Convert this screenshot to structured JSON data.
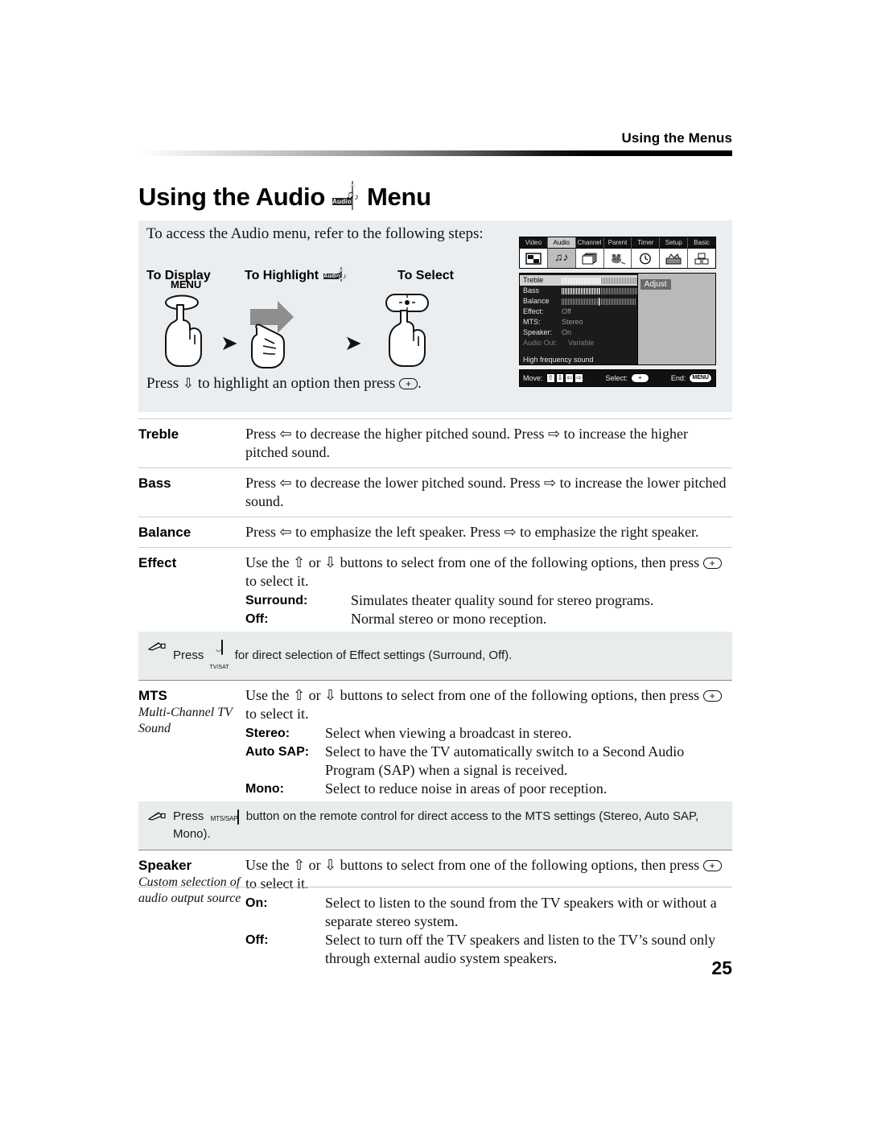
{
  "header": {
    "title": "Using the Menus"
  },
  "doc_title": {
    "before": "Using the Audio",
    "after": "Menu",
    "icon_label": "Audio"
  },
  "instructions": {
    "intro": "To access the Audio menu, refer to the following steps:",
    "step_display_label": "To Display",
    "step_highlight_label": "To Highlight",
    "step_highlight_icon_label": "Audio",
    "step_select_label": "To Select",
    "menu_button_label": "MENU",
    "footer_before": "Press",
    "footer_middle": "to highlight an option then press",
    "footer_end": ".",
    "footer_arrow": "⇩",
    "footer_select_glyph": "+"
  },
  "osd": {
    "tabs": [
      {
        "label": "Video",
        "icon": "video-icon",
        "glyph": "■",
        "active": false
      },
      {
        "label": "Audio",
        "icon": "audio-icon",
        "glyph": "♫",
        "active": true
      },
      {
        "label": "Channel",
        "icon": "channel-icon",
        "glyph": "❐",
        "active": false
      },
      {
        "label": "Parent",
        "icon": "parent-icon",
        "glyph": "◕",
        "active": false
      },
      {
        "label": "Timer",
        "icon": "timer-icon",
        "glyph": "◴",
        "active": false
      },
      {
        "label": "Setup",
        "icon": "setup-icon",
        "glyph": "⚒",
        "active": false
      },
      {
        "label": "Basic",
        "icon": "basic-icon",
        "glyph": "▦",
        "active": false
      }
    ],
    "rows": [
      {
        "label": "Treble",
        "type": "bar",
        "fill": 52,
        "selected": true,
        "dim": false
      },
      {
        "label": "Bass",
        "type": "bar",
        "fill": 50,
        "selected": false,
        "dim": false
      },
      {
        "label": "Balance",
        "type": "center",
        "fill": 50,
        "selected": false,
        "dim": false
      },
      {
        "label": "Effect:",
        "type": "value",
        "value": "Off",
        "selected": false,
        "dim": false
      },
      {
        "label": "MTS:",
        "type": "value",
        "value": "Stereo",
        "selected": false,
        "dim": false
      },
      {
        "label": "Speaker:",
        "type": "value",
        "value": "On",
        "selected": false,
        "dim": false
      },
      {
        "label": "Audio Out:",
        "type": "value",
        "value": "Variable",
        "selected": false,
        "dim": true
      }
    ],
    "hint": "High frequency sound",
    "adjust_label": "Adjust",
    "footer": {
      "move_label": "Move:",
      "move_keys": [
        "↑",
        "↓",
        "←",
        "→"
      ],
      "select_label": "Select:",
      "select_glyph": "+",
      "end_label": "End:",
      "end_glyph": "MENU"
    }
  },
  "settings": [
    {
      "term": "Treble",
      "subterm": "",
      "desc": "Press ⇦ to decrease the higher pitched sound. Press ⇨ to increase the higher pitched sound.",
      "options": []
    },
    {
      "term": "Bass",
      "subterm": "",
      "desc": "Press ⇦ to decrease the lower pitched sound. Press ⇨ to increase the lower pitched sound.",
      "options": []
    },
    {
      "term": "Balance",
      "subterm": "",
      "desc": "Press ⇦ to emphasize the left speaker. Press ⇨ to emphasize the right speaker.",
      "options": []
    },
    {
      "term": "Effect",
      "subterm": "",
      "desc_pre": "Use the ⇧ or ⇩ buttons to select from one of the following options, then press",
      "desc_post": "to select it.",
      "options": [
        {
          "name": "Surround:",
          "text": "Simulates theater quality sound for stereo programs."
        },
        {
          "name": "Off:",
          "text": "Normal stereo or mono reception."
        }
      ]
    },
    {
      "term": "MTS",
      "subterm": "Multi-Channel TV Sound",
      "desc_pre": "Use the ⇧ or ⇩ buttons to select from one of the following options, then press",
      "desc_post": "to select it.",
      "options": [
        {
          "name": "Stereo:",
          "text": "Select when viewing a broadcast in stereo."
        },
        {
          "name": "Auto SAP:",
          "text": "Select to have the TV automatically switch to a Second Audio Program (SAP) when a signal is received."
        },
        {
          "name": "Mono:",
          "text": "Select to reduce noise in areas of poor reception."
        }
      ]
    },
    {
      "term": "Speaker",
      "subterm": "Custom selection of audio output source",
      "desc_pre": "Use the ⇧ or ⇩ buttons to select from one of the following options, then press",
      "desc_post": "to select it.",
      "options": [
        {
          "name": "On:",
          "text": "Select to listen to the sound from the TV speakers with or without a separate stereo system."
        },
        {
          "name": "Off:",
          "text": "Select to turn off the TV speakers and listen to the TV’s sound only through external audio system speakers."
        }
      ]
    }
  ],
  "notes": [
    {
      "pre": "Press",
      "button_cap": "",
      "button_sub": "TV/SAT",
      "post": "for direct selection of Effect settings (Surround, Off)."
    },
    {
      "pre": "Press",
      "button_cap": "MTS/SAP",
      "button_sub": "",
      "post": "button on the remote control for direct access to the MTS settings (Stereo, Auto SAP, Mono)."
    }
  ],
  "page_number": "25"
}
